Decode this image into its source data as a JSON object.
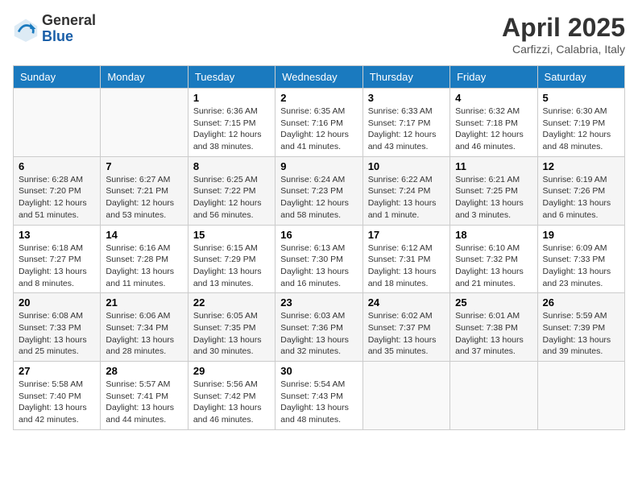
{
  "logo": {
    "general": "General",
    "blue": "Blue"
  },
  "title": "April 2025",
  "subtitle": "Carfizzi, Calabria, Italy",
  "days": [
    "Sunday",
    "Monday",
    "Tuesday",
    "Wednesday",
    "Thursday",
    "Friday",
    "Saturday"
  ],
  "weeks": [
    [
      {
        "day": "",
        "info": ""
      },
      {
        "day": "",
        "info": ""
      },
      {
        "day": "1",
        "info": "Sunrise: 6:36 AM\nSunset: 7:15 PM\nDaylight: 12 hours and 38 minutes."
      },
      {
        "day": "2",
        "info": "Sunrise: 6:35 AM\nSunset: 7:16 PM\nDaylight: 12 hours and 41 minutes."
      },
      {
        "day": "3",
        "info": "Sunrise: 6:33 AM\nSunset: 7:17 PM\nDaylight: 12 hours and 43 minutes."
      },
      {
        "day": "4",
        "info": "Sunrise: 6:32 AM\nSunset: 7:18 PM\nDaylight: 12 hours and 46 minutes."
      },
      {
        "day": "5",
        "info": "Sunrise: 6:30 AM\nSunset: 7:19 PM\nDaylight: 12 hours and 48 minutes."
      }
    ],
    [
      {
        "day": "6",
        "info": "Sunrise: 6:28 AM\nSunset: 7:20 PM\nDaylight: 12 hours and 51 minutes."
      },
      {
        "day": "7",
        "info": "Sunrise: 6:27 AM\nSunset: 7:21 PM\nDaylight: 12 hours and 53 minutes."
      },
      {
        "day": "8",
        "info": "Sunrise: 6:25 AM\nSunset: 7:22 PM\nDaylight: 12 hours and 56 minutes."
      },
      {
        "day": "9",
        "info": "Sunrise: 6:24 AM\nSunset: 7:23 PM\nDaylight: 12 hours and 58 minutes."
      },
      {
        "day": "10",
        "info": "Sunrise: 6:22 AM\nSunset: 7:24 PM\nDaylight: 13 hours and 1 minute."
      },
      {
        "day": "11",
        "info": "Sunrise: 6:21 AM\nSunset: 7:25 PM\nDaylight: 13 hours and 3 minutes."
      },
      {
        "day": "12",
        "info": "Sunrise: 6:19 AM\nSunset: 7:26 PM\nDaylight: 13 hours and 6 minutes."
      }
    ],
    [
      {
        "day": "13",
        "info": "Sunrise: 6:18 AM\nSunset: 7:27 PM\nDaylight: 13 hours and 8 minutes."
      },
      {
        "day": "14",
        "info": "Sunrise: 6:16 AM\nSunset: 7:28 PM\nDaylight: 13 hours and 11 minutes."
      },
      {
        "day": "15",
        "info": "Sunrise: 6:15 AM\nSunset: 7:29 PM\nDaylight: 13 hours and 13 minutes."
      },
      {
        "day": "16",
        "info": "Sunrise: 6:13 AM\nSunset: 7:30 PM\nDaylight: 13 hours and 16 minutes."
      },
      {
        "day": "17",
        "info": "Sunrise: 6:12 AM\nSunset: 7:31 PM\nDaylight: 13 hours and 18 minutes."
      },
      {
        "day": "18",
        "info": "Sunrise: 6:10 AM\nSunset: 7:32 PM\nDaylight: 13 hours and 21 minutes."
      },
      {
        "day": "19",
        "info": "Sunrise: 6:09 AM\nSunset: 7:33 PM\nDaylight: 13 hours and 23 minutes."
      }
    ],
    [
      {
        "day": "20",
        "info": "Sunrise: 6:08 AM\nSunset: 7:33 PM\nDaylight: 13 hours and 25 minutes."
      },
      {
        "day": "21",
        "info": "Sunrise: 6:06 AM\nSunset: 7:34 PM\nDaylight: 13 hours and 28 minutes."
      },
      {
        "day": "22",
        "info": "Sunrise: 6:05 AM\nSunset: 7:35 PM\nDaylight: 13 hours and 30 minutes."
      },
      {
        "day": "23",
        "info": "Sunrise: 6:03 AM\nSunset: 7:36 PM\nDaylight: 13 hours and 32 minutes."
      },
      {
        "day": "24",
        "info": "Sunrise: 6:02 AM\nSunset: 7:37 PM\nDaylight: 13 hours and 35 minutes."
      },
      {
        "day": "25",
        "info": "Sunrise: 6:01 AM\nSunset: 7:38 PM\nDaylight: 13 hours and 37 minutes."
      },
      {
        "day": "26",
        "info": "Sunrise: 5:59 AM\nSunset: 7:39 PM\nDaylight: 13 hours and 39 minutes."
      }
    ],
    [
      {
        "day": "27",
        "info": "Sunrise: 5:58 AM\nSunset: 7:40 PM\nDaylight: 13 hours and 42 minutes."
      },
      {
        "day": "28",
        "info": "Sunrise: 5:57 AM\nSunset: 7:41 PM\nDaylight: 13 hours and 44 minutes."
      },
      {
        "day": "29",
        "info": "Sunrise: 5:56 AM\nSunset: 7:42 PM\nDaylight: 13 hours and 46 minutes."
      },
      {
        "day": "30",
        "info": "Sunrise: 5:54 AM\nSunset: 7:43 PM\nDaylight: 13 hours and 48 minutes."
      },
      {
        "day": "",
        "info": ""
      },
      {
        "day": "",
        "info": ""
      },
      {
        "day": "",
        "info": ""
      }
    ]
  ]
}
